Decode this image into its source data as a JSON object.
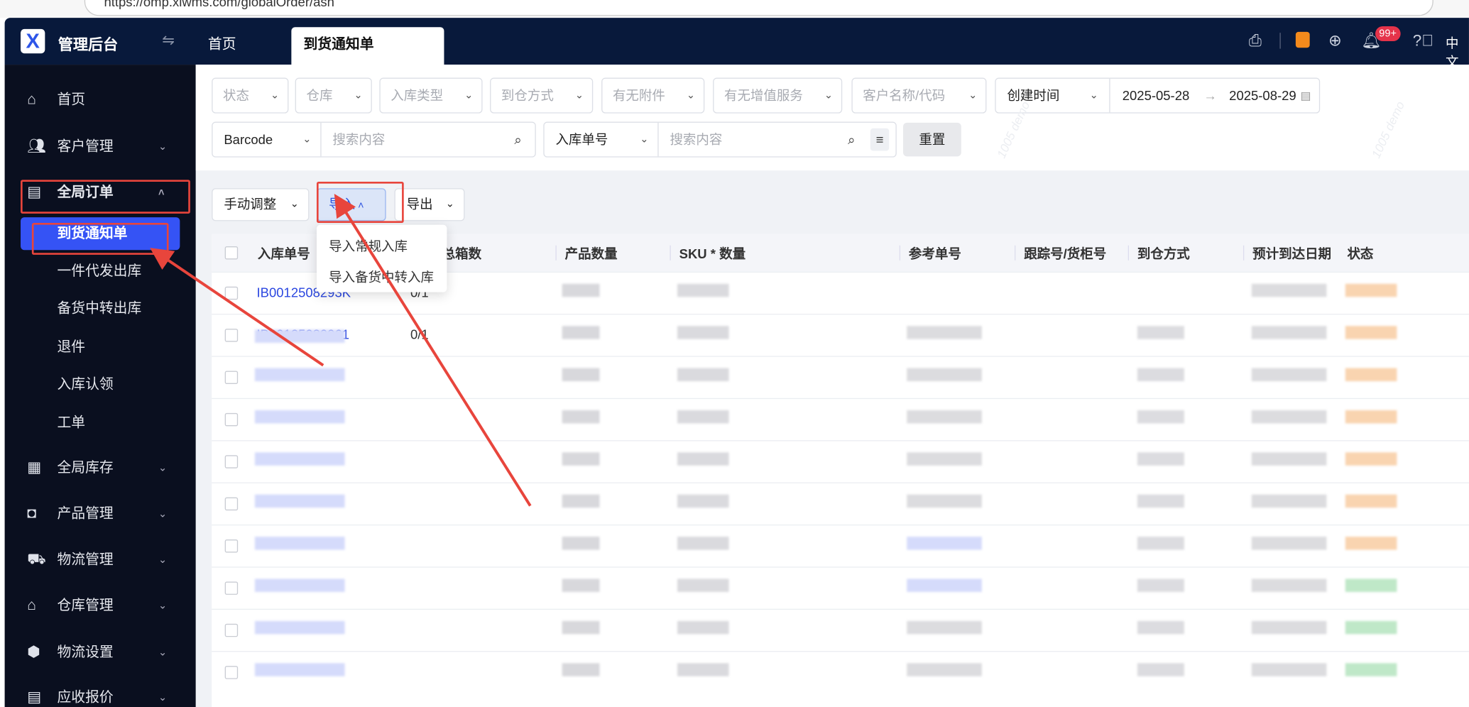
{
  "browser": {
    "url": "https://omp.xiwms.com/globalOrder/asn"
  },
  "header": {
    "brand": "管理后台",
    "tabs": [
      {
        "label": "首页"
      },
      {
        "label": "到货通知单"
      }
    ],
    "badge": "99+",
    "lang": "中文"
  },
  "sidebar": {
    "items": [
      {
        "label": "首页",
        "icon": "home-icon"
      },
      {
        "label": "客户管理",
        "icon": "users-icon"
      },
      {
        "label": "全局订单",
        "icon": "clipboard-icon"
      },
      {
        "label": "到货通知单"
      },
      {
        "label": "一件代发出库"
      },
      {
        "label": "备货中转出库"
      },
      {
        "label": "退件"
      },
      {
        "label": "入库认领"
      },
      {
        "label": "工单"
      },
      {
        "label": "全局库存",
        "icon": "warehouse-icon"
      },
      {
        "label": "产品管理",
        "icon": "bag-icon"
      },
      {
        "label": "物流管理",
        "icon": "truck-icon"
      },
      {
        "label": "仓库管理",
        "icon": "house-icon"
      },
      {
        "label": "物流设置",
        "icon": "box-gear-icon"
      },
      {
        "label": "应收报价",
        "icon": "document-icon"
      }
    ]
  },
  "filters": {
    "selects": [
      "状态",
      "仓库",
      "入库类型",
      "到仓方式",
      "有无附件",
      "有无增值服务",
      "客户名称/代码"
    ],
    "date_type": "创建时间",
    "date_start": "2025-05-28",
    "date_end": "2025-08-29",
    "search1_field": "Barcode",
    "search1_placeholder": "搜索内容",
    "search2_field": "入库单号",
    "search2_placeholder": "搜索内容",
    "reset": "重置",
    "watermark": "1005 demo"
  },
  "toolbar": {
    "manual": "手动调整",
    "import": "导入",
    "export": "导出"
  },
  "import_menu": [
    "导入常规入库",
    "导入备货中转入库"
  ],
  "table": {
    "columns": [
      "入库单号",
      "箱数/总箱数",
      "产品数量",
      "SKU * 数量",
      "参考单号",
      "跟踪号/货柜号",
      "到仓方式",
      "预计到达日期",
      "状态"
    ],
    "rows": [
      {
        "id": "IB0012508293K",
        "boxes": "0/1",
        "status": "orange"
      },
      {
        "id": "IB00125080061",
        "boxes": "0/1",
        "status": "orange"
      },
      {
        "status": "orange"
      },
      {
        "status": "orange"
      },
      {
        "status": "orange"
      },
      {
        "status": "orange"
      },
      {
        "status": "orange"
      },
      {
        "status": "green"
      },
      {
        "status": "green"
      },
      {
        "status": "green"
      }
    ]
  },
  "colors": {
    "accent": "#3553f5",
    "header": "#08193b",
    "annotation": "#e8453c",
    "orange": "#f9d4b0",
    "green": "#bfe8c8"
  }
}
